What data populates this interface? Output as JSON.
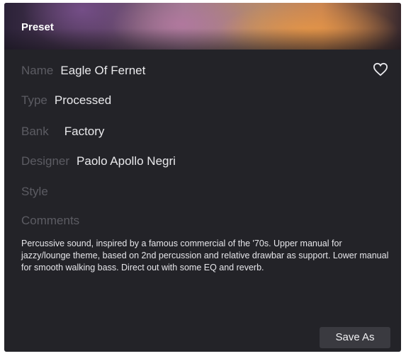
{
  "header": {
    "title": "Preset"
  },
  "fields": {
    "name": {
      "label": "Name",
      "value": "Eagle Of Fernet"
    },
    "type": {
      "label": "Type",
      "value": "Processed"
    },
    "bank": {
      "label": "Bank",
      "value": "Factory"
    },
    "designer": {
      "label": "Designer",
      "value": "Paolo Apollo Negri"
    },
    "style": {
      "label": "Style"
    },
    "comments": {
      "label": "Comments",
      "value": "Percussive sound, inspired by a famous commercial of the '70s. Upper manual for jazzy/lounge theme, based on 2nd percussion and relative drawbar as support. Lower manual for smooth walking bass. Direct out with some EQ and reverb."
    }
  },
  "actions": {
    "save_as": "Save As"
  },
  "icons": {
    "favorite": "heart-icon"
  },
  "colors": {
    "panel_bg": "#232328",
    "label": "#5c5c63",
    "value": "#e9e9ec",
    "button_bg": "#3a3a40"
  }
}
